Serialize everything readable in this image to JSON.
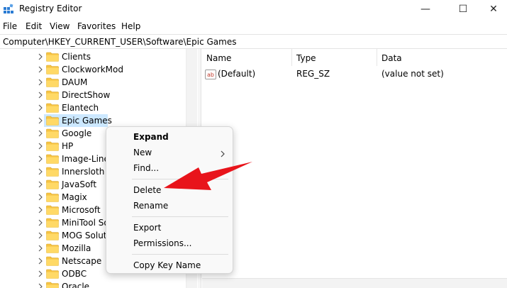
{
  "window": {
    "title": "Registry Editor",
    "minimize_glyph": "—",
    "maximize_glyph": "☐",
    "close_glyph": "✕"
  },
  "menu": [
    "File",
    "Edit",
    "View",
    "Favorites",
    "Help"
  ],
  "address": {
    "path": "Computer\\HKEY_CURRENT_USER\\Software\\Epic Games"
  },
  "tree": {
    "items": [
      {
        "label": "Clients"
      },
      {
        "label": "ClockworkMod"
      },
      {
        "label": "DAUM"
      },
      {
        "label": "DirectShow"
      },
      {
        "label": "Elantech"
      },
      {
        "label": "Epic Games",
        "selected": true
      },
      {
        "label": "Google"
      },
      {
        "label": "HP"
      },
      {
        "label": "Image-Line"
      },
      {
        "label": "Innersloth"
      },
      {
        "label": "JavaSoft"
      },
      {
        "label": "Magix"
      },
      {
        "label": "Microsoft"
      },
      {
        "label": "MiniTool So"
      },
      {
        "label": "MOG Soluti"
      },
      {
        "label": "Mozilla"
      },
      {
        "label": "Netscape"
      },
      {
        "label": "ODBC"
      },
      {
        "label": "Oracle"
      }
    ]
  },
  "list": {
    "columns": [
      "Name",
      "Type",
      "Data"
    ],
    "rows": [
      {
        "icon_text": "ab",
        "name": "(Default)",
        "type": "REG_SZ",
        "data": "(value not set)"
      }
    ]
  },
  "context_menu": {
    "items": [
      {
        "label": "Expand",
        "bold": true
      },
      {
        "label": "New",
        "submenu": true
      },
      {
        "label": "Find..."
      },
      {
        "label": "Delete"
      },
      {
        "label": "Rename"
      },
      {
        "label": "Export"
      },
      {
        "label": "Permissions..."
      },
      {
        "label": "Copy Key Name"
      }
    ]
  },
  "colors": {
    "annotation_arrow": "#e8141b",
    "selection": "#cce8ff",
    "folder": "#f6c343"
  }
}
